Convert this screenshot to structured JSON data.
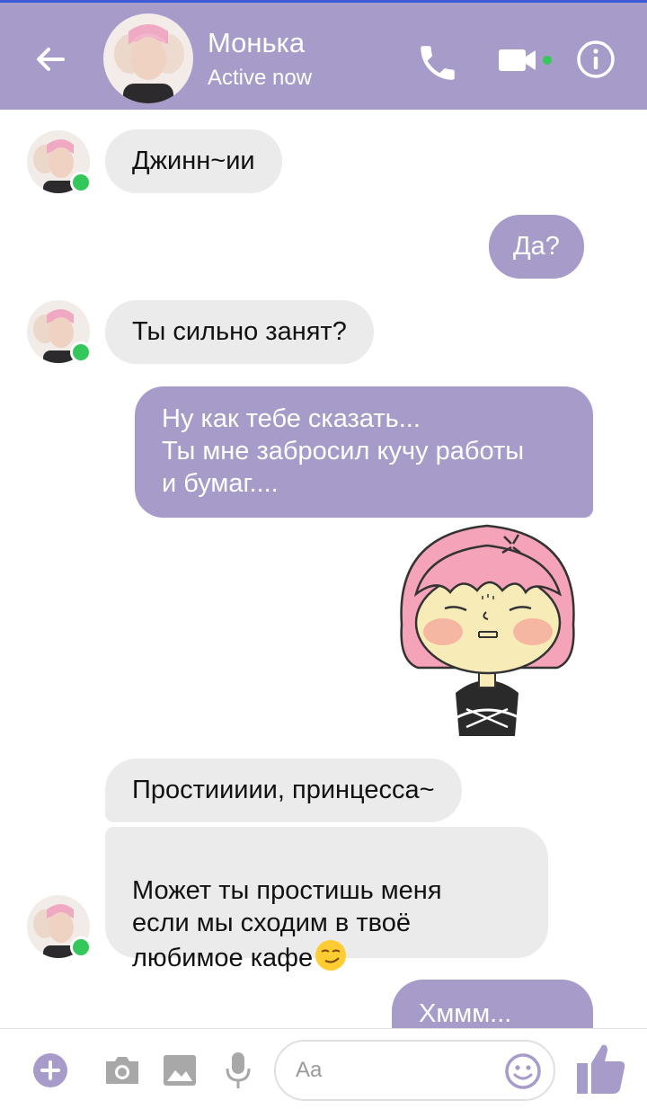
{
  "header": {
    "contact_name": "Монька",
    "status": "Active now",
    "back_icon": "arrow-left-icon",
    "call_icon": "phone-icon",
    "video_icon": "video-camera-icon",
    "info_icon": "info-icon"
  },
  "messages": [
    {
      "sender": "contact",
      "text": "Джинн~ии",
      "avatar": true
    },
    {
      "sender": "me",
      "text": "Да?"
    },
    {
      "sender": "contact",
      "text": "Ты сильно занят?",
      "avatar": true
    },
    {
      "sender": "me",
      "text": "Ну как тебе сказать...\nТы мне забросил кучу работы\nи бумаг...."
    },
    {
      "sender": "me",
      "type": "sticker",
      "sticker": "angry-pink-haired-girl-sticker"
    },
    {
      "sender": "contact",
      "text": "Простиииии, принцесса~"
    },
    {
      "sender": "contact",
      "text": "Может ты простишь меня\nесли мы сходим в твоё\nлюбимое кафе",
      "emoji": "smirking-face-emoji",
      "avatar": true
    },
    {
      "sender": "me",
      "text": "Хммм..."
    }
  ],
  "composer": {
    "placeholder": "Aa",
    "icons": [
      "plus-icon",
      "camera-icon",
      "image-icon",
      "microphone-icon",
      "emoji-icon",
      "thumbs-up-icon"
    ]
  },
  "colors": {
    "accent": "#a79bc9",
    "incoming_bubble": "#ebebeb",
    "online": "#34c759"
  }
}
